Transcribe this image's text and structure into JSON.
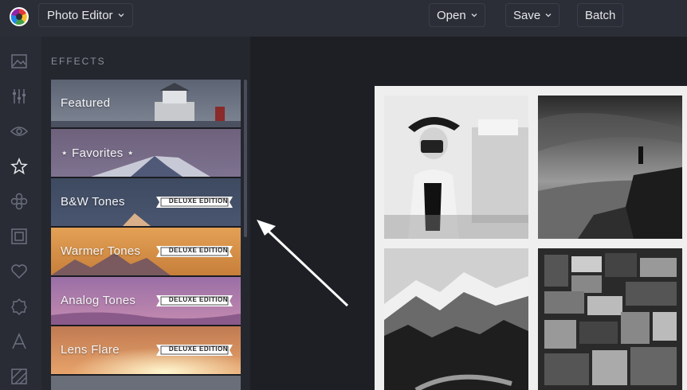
{
  "topbar": {
    "app_menu_label": "Photo Editor",
    "open_label": "Open",
    "save_label": "Save",
    "batch_label": "Batch"
  },
  "rail": {
    "icons": [
      "image-icon",
      "sliders-icon",
      "eye-icon",
      "star-icon",
      "flower-icon",
      "frame-icon",
      "heart-icon",
      "badge-icon",
      "text-icon",
      "texture-icon"
    ],
    "active": "star-icon"
  },
  "effects_panel": {
    "title": "EFFECTS",
    "badge_text": "DELUXE EDITION",
    "items": [
      {
        "label": "Featured",
        "deluxe": false
      },
      {
        "label": "⋆ Favorites ⋆",
        "deluxe": false
      },
      {
        "label": "B&W Tones",
        "deluxe": true
      },
      {
        "label": "Warmer Tones",
        "deluxe": true
      },
      {
        "label": "Analog Tones",
        "deluxe": true
      },
      {
        "label": "Lens Flare",
        "deluxe": true
      }
    ]
  },
  "colors": {
    "topbar": "#2c2e37",
    "panel": "#25272f",
    "canvas": "#1e1f25",
    "artboard": "#efefef"
  }
}
